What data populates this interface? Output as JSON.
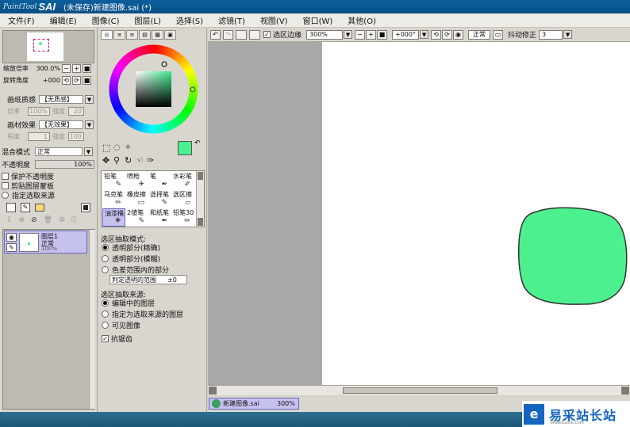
{
  "app": {
    "logo_prefix": "PaintTool",
    "logo_name": "SAI",
    "title": "(未保存)新建图像.sai (*)"
  },
  "menu": [
    "文件(F)",
    "编辑(E)",
    "图像(C)",
    "图层(L)",
    "选择(S)",
    "滤镜(T)",
    "视图(V)",
    "窗口(W)",
    "其他(O)"
  ],
  "navigator": {
    "zoom_label": "缩放倍率",
    "zoom_value": "300.0%",
    "rotate_label": "旋转角度",
    "rotate_value": "+000"
  },
  "paper": {
    "texture_label": "画纸质感",
    "texture_value": "【无质感】",
    "scale_label": "倍率",
    "scale_value": "100%",
    "strength_label": "强度",
    "strength_value": "20",
    "effect_label": "画材效果",
    "effect_value": "【无效果】",
    "degree_label": "程度",
    "degree_value": "1",
    "strength2_label": "强度",
    "strength2_value": "100"
  },
  "layer_props": {
    "blend_label": "混合模式",
    "blend_value": "正常",
    "opacity_label": "不透明度",
    "opacity_value": "100%",
    "opacity_fraction": 1.0,
    "protect_label": "保护不透明度",
    "clip_label": "剪贴图层蒙板",
    "source_label": "指定选取来源"
  },
  "layers": [
    {
      "name": "图层1",
      "mode": "正常",
      "opacity": "100%"
    }
  ],
  "color": {
    "current": "#4cf08e",
    "secondary": "#ffffff"
  },
  "tools": [
    {
      "label": "铅笔",
      "icon": "pencil-icon",
      "glyph": "✎"
    },
    {
      "label": "喷枪",
      "icon": "airbrush-icon",
      "glyph": "✈"
    },
    {
      "label": "笔",
      "icon": "brush-icon",
      "glyph": "✒"
    },
    {
      "label": "水彩笔",
      "icon": "watercolor-icon",
      "glyph": "✐"
    },
    {
      "label": "马克笔",
      "icon": "marker-icon",
      "glyph": "✏"
    },
    {
      "label": "橡皮擦",
      "icon": "eraser-icon",
      "glyph": "▭"
    },
    {
      "label": "选择笔",
      "icon": "select-pen-icon",
      "glyph": "✎"
    },
    {
      "label": "选区擦",
      "icon": "select-eraser-icon",
      "glyph": "▱"
    },
    {
      "label": "油漆桶",
      "icon": "bucket-icon",
      "glyph": "◈"
    },
    {
      "label": "2値笔",
      "icon": "binary-pen-icon",
      "glyph": "✎"
    },
    {
      "label": "和纸笔",
      "icon": "washi-pen-icon",
      "glyph": "✒"
    },
    {
      "label": "铅笔30",
      "icon": "pencil30-icon",
      "glyph": "✏"
    }
  ],
  "fill_options": {
    "mode_title": "选区抽取模式:",
    "modes": [
      "透明部分(精确)",
      "透明部分(模糊)",
      "色差范围内的部分"
    ],
    "selected_mode": 0,
    "range_label": "判定透明的范围",
    "range_value": "±0",
    "source_title": "选区抽取来源:",
    "sources": [
      "编辑中的图层",
      "指定为选取来源的图层",
      "可见图像"
    ],
    "selected_source": 0,
    "antialias_label": "抗锯齿"
  },
  "canvas_toolbar": {
    "selection_edge_label": "选区边缘",
    "zoom": "300%",
    "angle": "+000°",
    "mode": "正常",
    "stabilizer_label": "抖动修正",
    "stabilizer_value": "3"
  },
  "document_tab": {
    "name": "新建图像.sai",
    "zoom": "300%"
  },
  "watermark": {
    "text": "易采站长站",
    "sub": "Www.Easck.Com"
  }
}
